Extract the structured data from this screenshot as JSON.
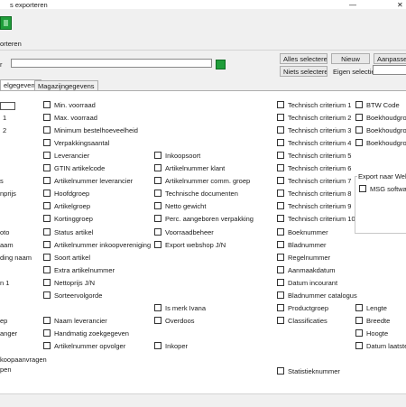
{
  "window": {
    "title": "s exporteren",
    "min": "—",
    "close": "✕"
  },
  "ribbon": {
    "label": "orteren",
    "icon": "excel-icon"
  },
  "file": {
    "prefix": "r",
    "value": "",
    "excel_button_icon": "excel-icon"
  },
  "buttons": {
    "select_all": "Alles selecteren",
    "select_none": "Niets selecteren",
    "new": "Nieuw",
    "customize": "Aanpasse",
    "eigen_selectie_label": "Eigen selectie"
  },
  "tabs": [
    "elgegevens",
    "Magazijngegevens"
  ],
  "left_fragments": [
    "1",
    "2",
    "s",
    "nprijs",
    "oto",
    "aam",
    "ding naam",
    "n 1",
    "ep",
    "anger",
    "koopaanvragen",
    "pen"
  ],
  "col1": [
    "Min. voorraad",
    "Max. voorraad",
    "Minimum bestelhoeveelheid",
    "Verpakkingsaantal",
    "Leverancier",
    "GTIN artikelcode",
    "Artikelnummer leverancier",
    "Hoofdgroep",
    "Artikelgroep",
    "Kortinggroep",
    "Status artikel",
    "Artikelnummer inkoopvereniging",
    "Soort artikel",
    "Extra artikelnummer",
    "Nettoprijs J/N",
    "Sorteervolgorde",
    "Naam leverancier",
    "Handmatig zoekgegeven",
    "Artikelnummer opvolger"
  ],
  "col2": [
    "Inkoopsoort",
    "Artikelnummer klant",
    "Artikelnummer comm. groep",
    "Technische documenten",
    "Netto gewicht",
    "Perc. aangeboren verpakking",
    "Voorraadbeheer",
    "Export webshop J/N",
    "Is merk Ivana",
    "Overdoos",
    "Inkoper"
  ],
  "col3": [
    "Technisch criterium 1",
    "Technisch criterium 2",
    "Technisch criterium 3",
    "Technisch criterium 4",
    "Technisch criterium 5",
    "Technisch criterium 6",
    "Technisch criterium 7",
    "Technisch criterium 8",
    "Technisch criterium 9",
    "Technisch criterium 10",
    "Boeknummer",
    "Bladnummer",
    "Regelnummer",
    "Aanmaakdatum",
    "Datum incourant",
    "Bladnummer catalogus",
    "Productgroep",
    "Classificaties",
    "Statistieknummer"
  ],
  "col4": [
    "BTW Code",
    "Boekhoudgroep",
    "Boekhoudgroep",
    "Boekhoudgroep",
    "Lengte",
    "Breedte",
    "Hoogte",
    "Datum laatste v"
  ],
  "export_group": {
    "title": "Export naar Websh",
    "item": "MSG software"
  }
}
